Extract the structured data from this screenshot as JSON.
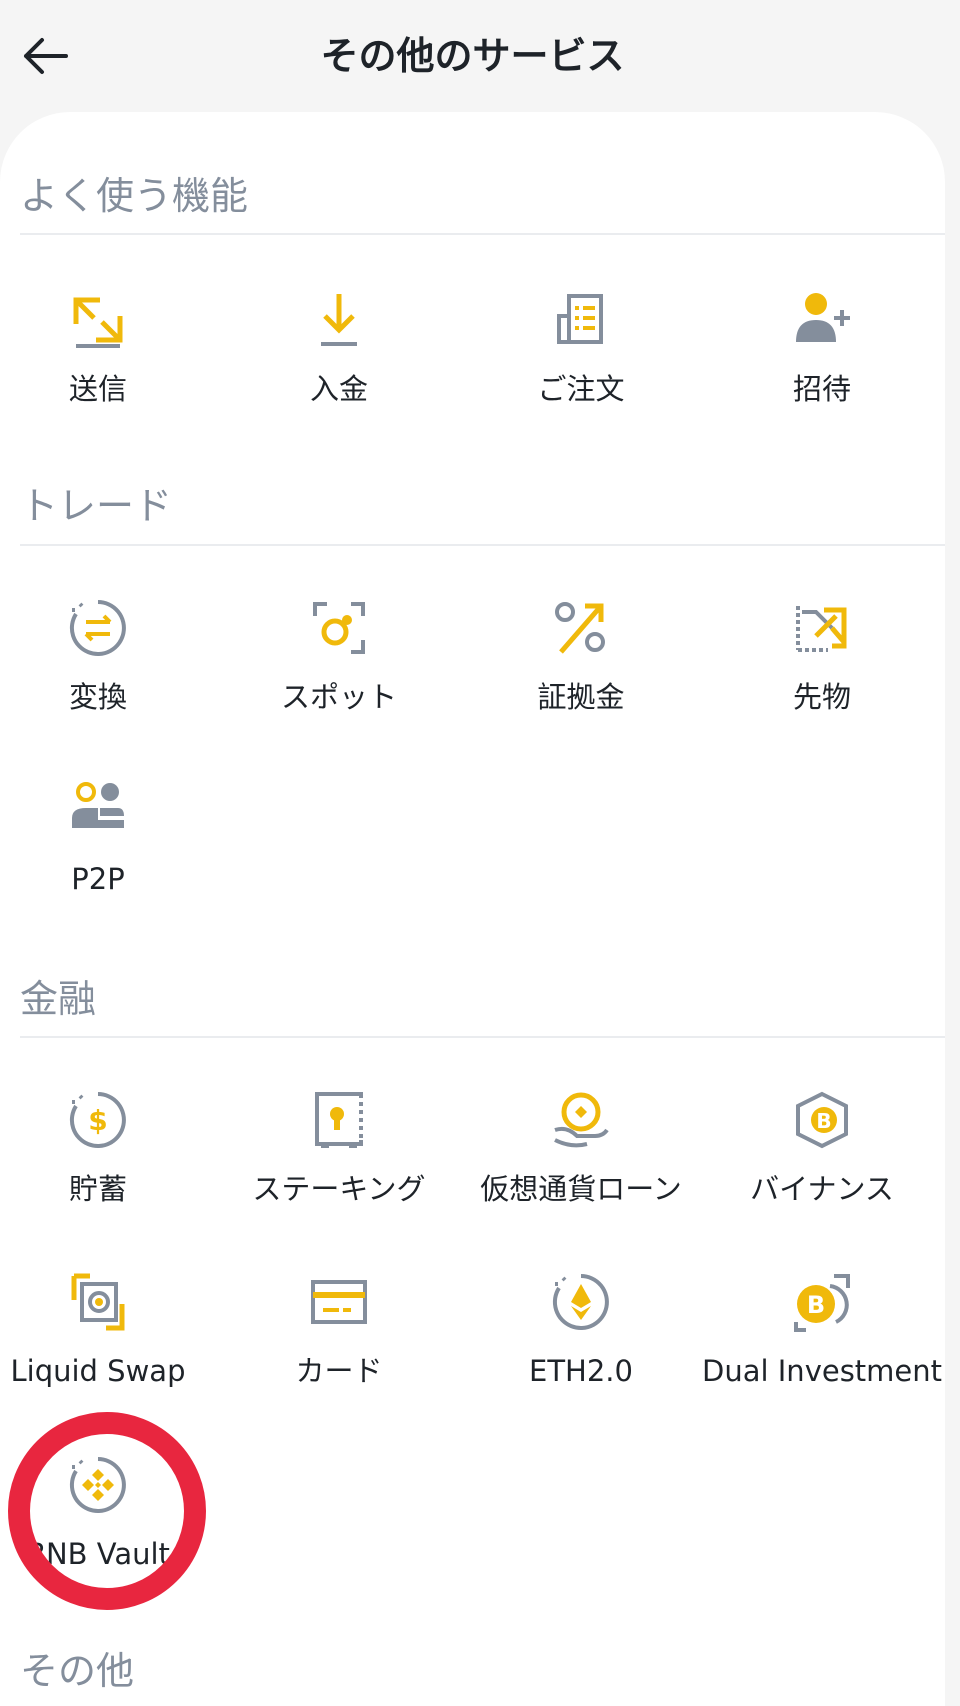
{
  "header": {
    "title": "その他のサービス",
    "back_icon": "arrow-left-icon"
  },
  "colors": {
    "accent": "#F0B90B",
    "icon_gray": "#848E9C",
    "ring": "#E8263F"
  },
  "sections": {
    "frequent": {
      "title": "よく使う機能",
      "items": [
        {
          "label": "送信",
          "icon": "send-icon"
        },
        {
          "label": "入金",
          "icon": "deposit-icon"
        },
        {
          "label": "ご注文",
          "icon": "orders-icon"
        },
        {
          "label": "招待",
          "icon": "invite-icon"
        }
      ]
    },
    "trade": {
      "title": "トレード",
      "items": [
        {
          "label": "変換",
          "icon": "convert-icon"
        },
        {
          "label": "スポット",
          "icon": "spot-icon"
        },
        {
          "label": "証拠金",
          "icon": "margin-icon"
        },
        {
          "label": "先物",
          "icon": "futures-icon"
        },
        {
          "label": "P2P",
          "icon": "p2p-icon"
        }
      ]
    },
    "finance": {
      "title": "金融",
      "items": [
        {
          "label": "貯蓄",
          "icon": "savings-icon"
        },
        {
          "label": "ステーキング",
          "icon": "staking-icon"
        },
        {
          "label": "仮想通貨ローン",
          "icon": "crypto-loan-icon"
        },
        {
          "label": "バイナンス",
          "icon": "binance-pool-icon"
        },
        {
          "label": "Liquid Swap",
          "icon": "liquid-swap-icon"
        },
        {
          "label": "カード",
          "icon": "card-icon"
        },
        {
          "label": "ETH2.0",
          "icon": "eth2-icon"
        },
        {
          "label": "Dual Investment",
          "icon": "dual-investment-icon"
        },
        {
          "label": "BNB Vault",
          "icon": "bnb-vault-icon"
        }
      ]
    },
    "other": {
      "title": "その他"
    }
  }
}
